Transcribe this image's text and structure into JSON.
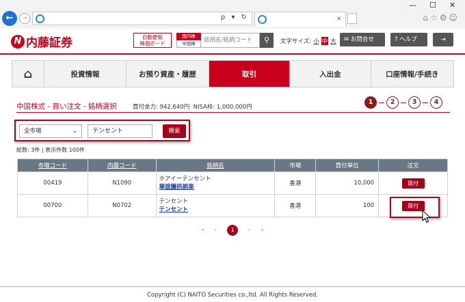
{
  "browser": {
    "win_min": "—",
    "win_max": "☐",
    "win_close": "✕",
    "addr_tools": "ρ ▾ ↻",
    "tab_close": "×",
    "top_icons": "⌂☆⚙☺"
  },
  "header": {
    "logo_mark": "N",
    "logo_text": "内藤証券",
    "board_line1": "自動更新",
    "board_line2": "株価ボード",
    "stock_type_top": "国内株",
    "stock_type_bottom": "中国株",
    "search_placeholder": "銘柄名/銘柄コード",
    "fontsize_label": "文字サイズ:",
    "fontsize_small": "小",
    "fontsize_mid": "中",
    "fontsize_large": "大",
    "contact_label": "お問合せ",
    "help_label": "ヘルプ"
  },
  "nav": {
    "items": [
      "投資情報",
      "お預り資産・履歴",
      "取引",
      "入出金",
      "口座情報/手続き"
    ]
  },
  "page": {
    "title": "中国株式 - 買い注文 - 銘柄選択",
    "buying_power": "買付余力: 942,640円",
    "nisa": "NISA枠: 1,000,000円",
    "steps": [
      "1",
      "2",
      "3",
      "4"
    ]
  },
  "filter": {
    "market": "全市場",
    "keyword": "テンセント",
    "search_label": "検索"
  },
  "count_text": "総数: 3件 | 表示件数 100件",
  "table": {
    "headers": [
      "市場コード",
      "内藤コード",
      "銘柄名",
      "市場",
      "買付単位",
      "注文"
    ],
    "rows": [
      {
        "market_code": "00419",
        "naito_code": "N1090",
        "name_kana": "ホアイーテンセント",
        "name_link": "華誼騰訊娯楽",
        "market": "香港",
        "unit": "10,000",
        "order": "買付"
      },
      {
        "market_code": "00700",
        "naito_code": "N0702",
        "name_kana": "テンセント",
        "name_link": "テンセント",
        "market": "香港",
        "unit": "100",
        "order": "買付"
      }
    ]
  },
  "pager": {
    "first": "«",
    "prev": "‹",
    "current": "1",
    "next": "›",
    "last": "»"
  },
  "footer": {
    "copyright": "Copyright (C) NAITO Securities co.,ltd. All Rights Reserved."
  },
  "colors": {
    "brand_red": "#c8001e",
    "button_red": "#a8001a",
    "table_header": "#6a7886",
    "link_blue": "#1a3ea8"
  }
}
